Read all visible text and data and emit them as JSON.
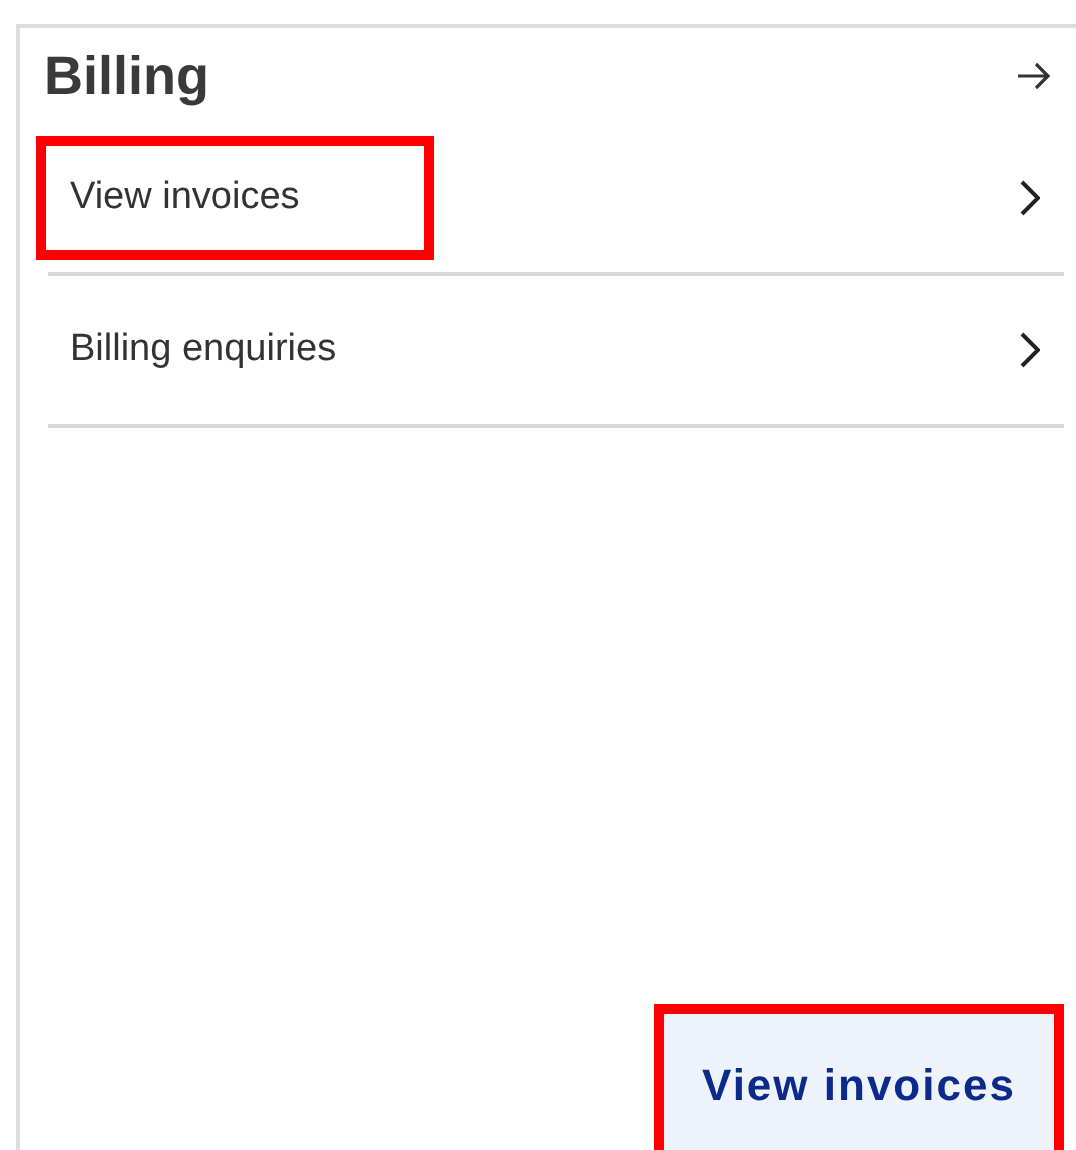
{
  "card": {
    "title": "Billing",
    "items": [
      {
        "label": "View invoices",
        "highlighted": true
      },
      {
        "label": "Billing enquiries",
        "highlighted": false
      }
    ],
    "button": {
      "label": "View invoices",
      "highlighted": true
    }
  }
}
